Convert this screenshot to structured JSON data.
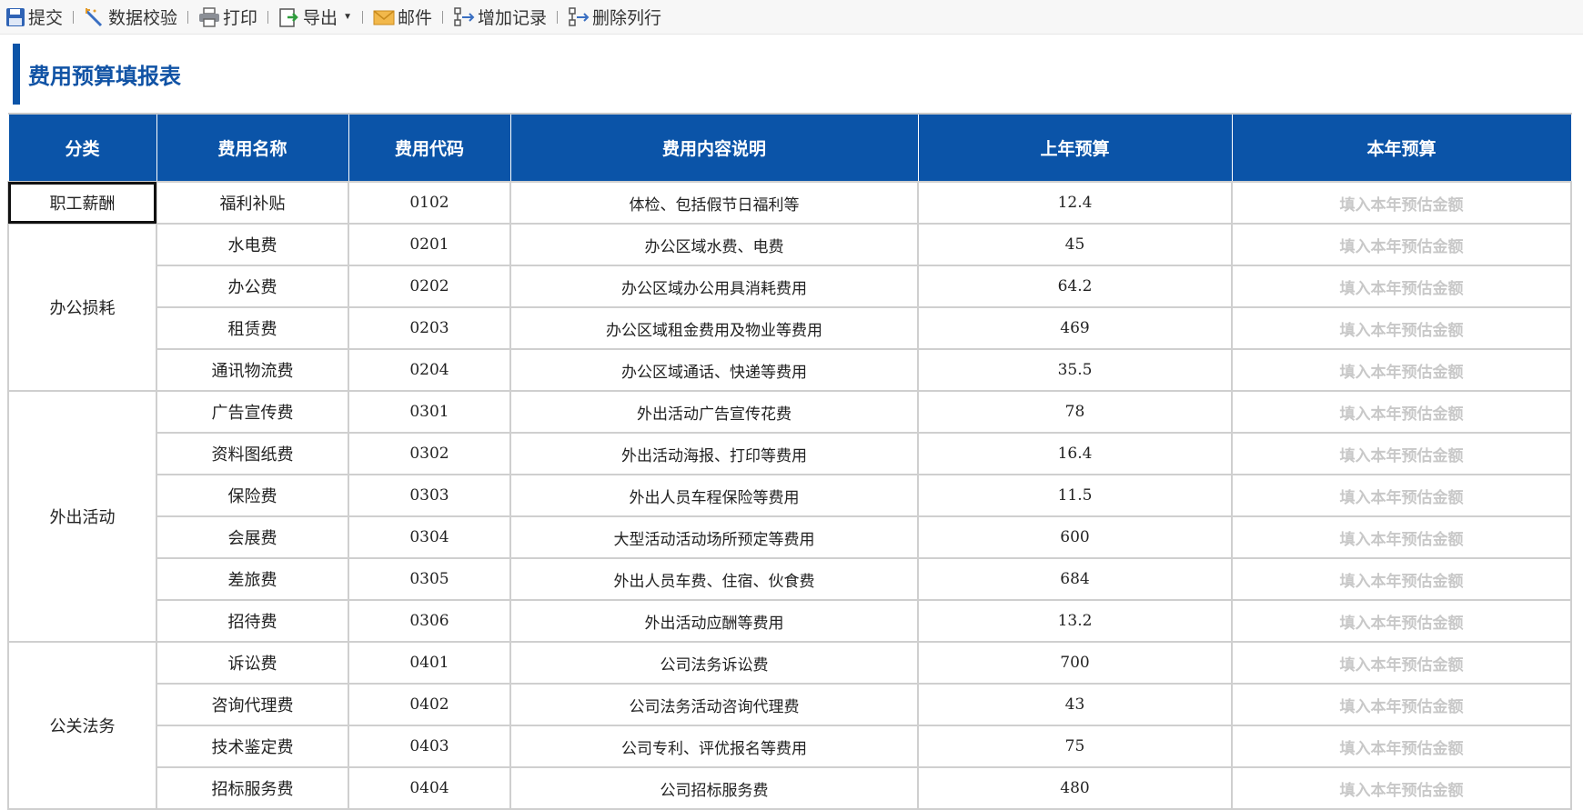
{
  "toolbar": {
    "items": [
      {
        "label": "提交",
        "icon": "save-icon"
      },
      {
        "label": "数据校验",
        "icon": "validate-icon"
      },
      {
        "label": "打印",
        "icon": "print-icon"
      },
      {
        "label": "导出",
        "icon": "export-icon"
      },
      {
        "label": "邮件",
        "icon": "mail-icon"
      },
      {
        "label": "增加记录",
        "icon": "add-record-icon"
      },
      {
        "label": "删除列行",
        "icon": "delete-row-icon"
      }
    ]
  },
  "title": "费用预算填报表",
  "colors": {
    "accent": "#0b54a8",
    "placeholder": "#c8c8c8"
  },
  "table": {
    "headers": [
      "分类",
      "费用名称",
      "费用代码",
      "费用内容说明",
      "上年预算",
      "本年预算"
    ],
    "placeholder": "填入本年预估金额",
    "categories": [
      "职工薪酬",
      "办公损耗",
      "外出活动",
      "公关法务"
    ],
    "rows": [
      {
        "name": "福利补贴",
        "code": "0102",
        "desc": "体检、包括假节日福利等",
        "last": "12.4"
      },
      {
        "name": "水电费",
        "code": "0201",
        "desc": "办公区域水费、电费",
        "last": "45"
      },
      {
        "name": "办公费",
        "code": "0202",
        "desc": "办公区域办公用具消耗费用",
        "last": "64.2"
      },
      {
        "name": "租赁费",
        "code": "0203",
        "desc": "办公区域租金费用及物业等费用",
        "last": "469"
      },
      {
        "name": "通讯物流费",
        "code": "0204",
        "desc": "办公区域通话、快递等费用",
        "last": "35.5"
      },
      {
        "name": "广告宣传费",
        "code": "0301",
        "desc": "外出活动广告宣传花费",
        "last": "78"
      },
      {
        "name": "资料图纸费",
        "code": "0302",
        "desc": "外出活动海报、打印等费用",
        "last": "16.4"
      },
      {
        "name": "保险费",
        "code": "0303",
        "desc": "外出人员车程保险等费用",
        "last": "11.5"
      },
      {
        "name": "会展费",
        "code": "0304",
        "desc": "大型活动活动场所预定等费用",
        "last": "600"
      },
      {
        "name": "差旅费",
        "code": "0305",
        "desc": "外出人员车费、住宿、伙食费",
        "last": "684"
      },
      {
        "name": "招待费",
        "code": "0306",
        "desc": "外出活动应酬等费用",
        "last": "13.2"
      },
      {
        "name": "诉讼费",
        "code": "0401",
        "desc": "公司法务诉讼费",
        "last": "700"
      },
      {
        "name": "咨询代理费",
        "code": "0402",
        "desc": "公司法务活动咨询代理费",
        "last": "43"
      },
      {
        "name": "技术鉴定费",
        "code": "0403",
        "desc": "公司专利、评优报名等费用",
        "last": "75"
      },
      {
        "name": "招标服务费",
        "code": "0404",
        "desc": "公司招标服务费",
        "last": "480"
      }
    ]
  }
}
